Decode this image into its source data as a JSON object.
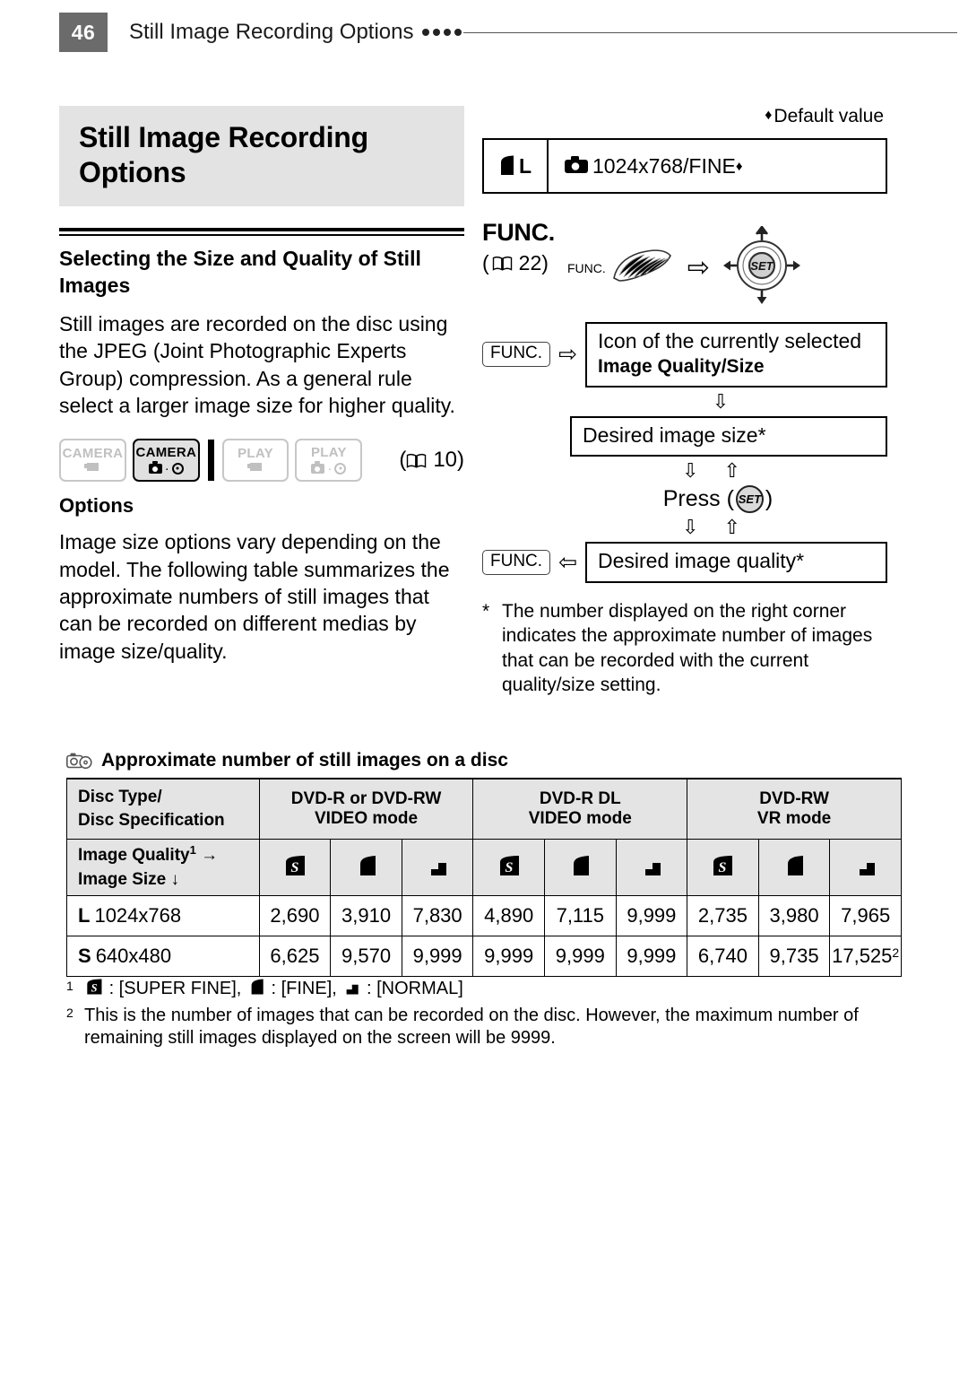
{
  "header": {
    "page_number": "46",
    "title": "Still Image Recording Options",
    "dot_count": 4
  },
  "left_column": {
    "chapter_title_line1": "Still Image Recording",
    "chapter_title_line2": "Options",
    "section_title": "Selecting the Size and Quality of Still Images",
    "intro_paragraph": "Still images are recorded on the disc using the JPEG (Joint Photographic Experts Group) compression. As a general rule select a larger image size for higher quality.",
    "mode_badges": [
      {
        "label": "CAMERA",
        "icon": "video-camera-icon",
        "active": false
      },
      {
        "label": "CAMERA",
        "icon": "photo-disc-icon",
        "active": true
      },
      {
        "label": "PLAY",
        "icon": "video-camera-icon",
        "active": false
      },
      {
        "label": "PLAY",
        "icon": "photo-disc-icon",
        "active": false
      }
    ],
    "mode_reference": "10",
    "options_heading": "Options",
    "options_paragraph": "Image size options vary depending on the model. The following table summarizes the approximate numbers of still images that can be recorded on different medias by image size/quality."
  },
  "right_column": {
    "default_value_note": "Default value",
    "default_value_mark": "♦",
    "default_row": {
      "size_label": "L",
      "value": "1024x768/FINE",
      "value_mark": "♦"
    },
    "func_heading": "FUNC.",
    "func_reference": "22",
    "func_button_label": "FUNC.",
    "arrow_right": "⇨",
    "flow": {
      "step1_tag": "FUNC.",
      "step1_arrow": "⇨",
      "step1_line1": "Icon of the currently selected",
      "step1_line2": "Image Quality/Size",
      "arrow_down_single": "⇩",
      "step2_text": "Desired image size*",
      "arrow_down_up": "⇩ ⇧",
      "press_prefix": "Press (",
      "press_button": "SET",
      "press_suffix": ")",
      "step3_tag": "FUNC.",
      "step3_arrow": "⇦",
      "step3_text": "Desired image quality*"
    },
    "footnote_mark": "*",
    "footnote_text": "The number displayed on the right corner indicates the approximate number of images that can be recorded with the current quality/size setting."
  },
  "table_section": {
    "caption": "Approximate number of still images on a disc",
    "caption_icon": "camera-disc-icon",
    "header_row_label_line1": "Disc Type/",
    "header_row_label_line2": "Disc Specification",
    "disc_groups": [
      {
        "type": "DVD-R or DVD-RW",
        "mode": "VIDEO mode"
      },
      {
        "type": "DVD-R DL",
        "mode": "VIDEO mode"
      },
      {
        "type": "DVD-RW",
        "mode": "VR mode"
      }
    ],
    "quality_row_label_line1": "Image Quality",
    "quality_row_label_line1_sup": "1",
    "quality_row_label_line1_arrow": "→",
    "quality_row_label_line2": "Image Size",
    "quality_row_label_line2_arrow": "↓",
    "quality_icons": [
      "super-fine-icon",
      "fine-icon",
      "normal-icon",
      "super-fine-icon",
      "fine-icon",
      "normal-icon",
      "super-fine-icon",
      "fine-icon",
      "normal-icon"
    ],
    "rows": [
      {
        "size_badge": "L",
        "size_label": "1024x768",
        "values": [
          "2,690",
          "3,910",
          "7,830",
          "4,890",
          "7,115",
          "9,999",
          "2,735",
          "3,980",
          "7,965"
        ],
        "value_sups": [
          "",
          "",
          "",
          "",
          "",
          "",
          "",
          "",
          ""
        ]
      },
      {
        "size_badge": "S",
        "size_label": "640x480",
        "values": [
          "6,625",
          "9,570",
          "9,999",
          "9,999",
          "9,999",
          "9,999",
          "6,740",
          "9,735",
          "17,525"
        ],
        "value_sups": [
          "",
          "",
          "",
          "",
          "",
          "",
          "",
          "",
          "2"
        ]
      }
    ],
    "notes": [
      {
        "num": "1",
        "text_parts": [
          ": [SUPER FINE], ",
          ": [FINE], ",
          ": [NORMAL]"
        ],
        "full_text": ": [SUPER FINE],  : [FINE],  : [NORMAL]"
      },
      {
        "num": "2",
        "full_text": "This is the number of images that can be recorded on the disc. However, the maximum number of remaining still images displayed on the screen will be 9999."
      }
    ]
  },
  "colors": {
    "folio_background": "#6b6b6b",
    "chapter_band": "#e3e3e3",
    "table_header_background": "#e4e4e4",
    "set_button_fill": "#d9d9d9",
    "inactive_badge": "#c0c0c0"
  }
}
